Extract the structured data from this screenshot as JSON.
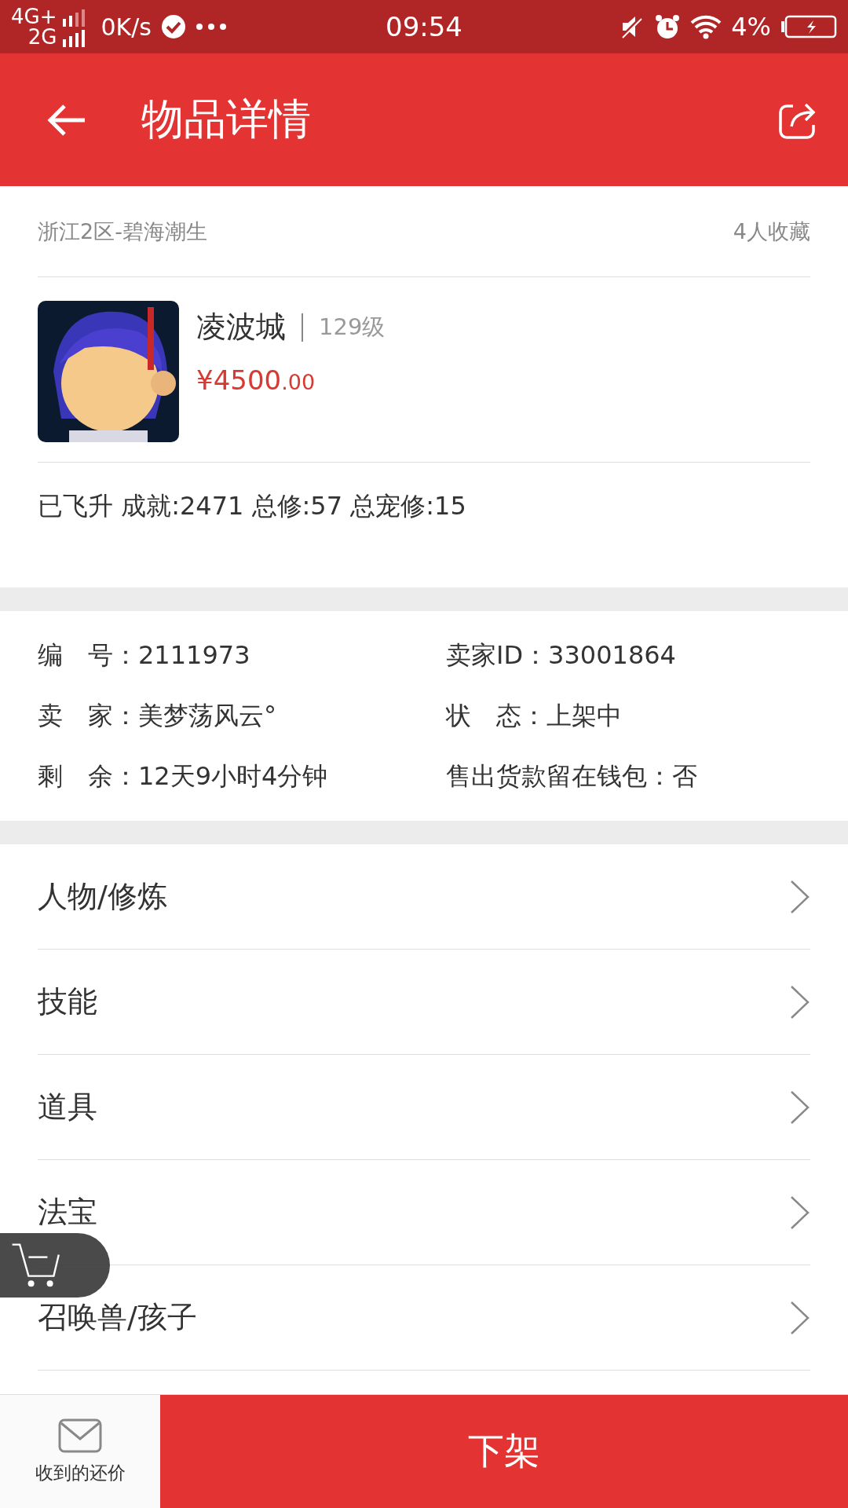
{
  "status_bar": {
    "network_top": "4G+",
    "network_bottom": "2G",
    "speed": "0K/s",
    "time": "09:54",
    "battery": "4%"
  },
  "header": {
    "title": "物品详情"
  },
  "item": {
    "server": "浙江2区-碧海潮生",
    "favorites": "4人收藏",
    "name": "凌波城",
    "level": "129级",
    "price": "¥4500",
    "price_cents": ".00",
    "stats": "已飞升 成就:2471 总修:57 总宠修:15"
  },
  "info": [
    {
      "text": "编　号：2111973"
    },
    {
      "text": "卖家ID：33001864"
    },
    {
      "text": "卖　家：美梦荡风云°"
    },
    {
      "text": "状　态：上架中"
    },
    {
      "text": "剩　余：12天9小时4分钟"
    },
    {
      "text": "售出货款留在钱包：否"
    }
  ],
  "sections": [
    {
      "label": "人物/修炼"
    },
    {
      "label": "技能"
    },
    {
      "label": "道具"
    },
    {
      "label": "法宝"
    },
    {
      "label": "召唤兽/孩子"
    }
  ],
  "bottom_bar": {
    "offers": "收到的还价",
    "action": "下架"
  }
}
